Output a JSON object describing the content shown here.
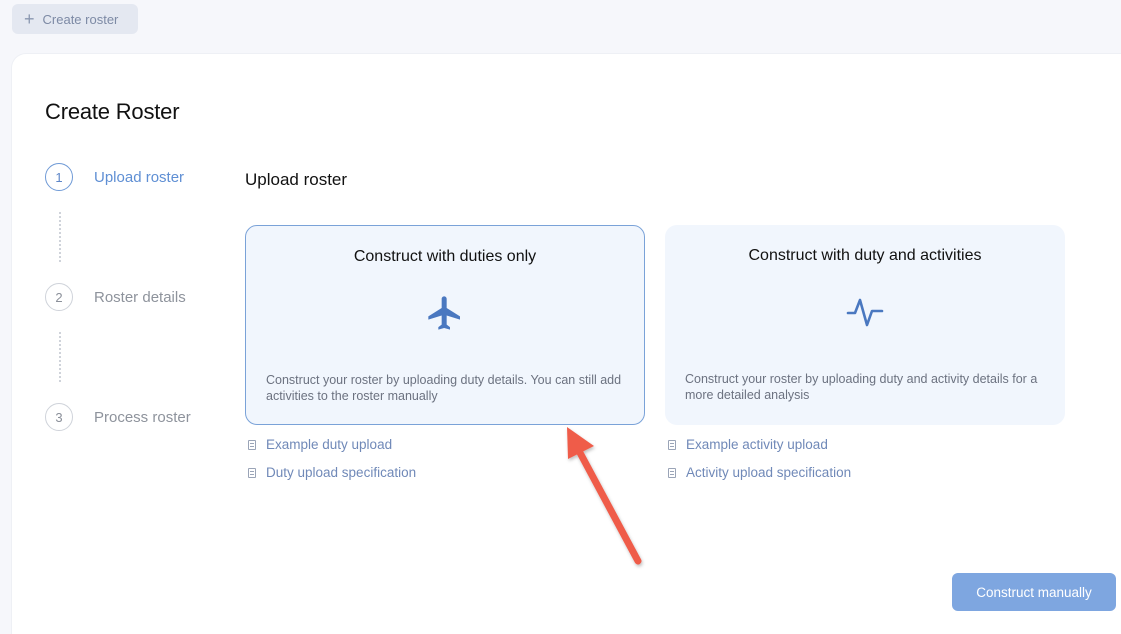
{
  "top_bar": {
    "create_roster_label": "Create roster",
    "plus_icon": "plus-icon"
  },
  "dialog": {
    "title": "Create Roster"
  },
  "steps": [
    {
      "number": "1",
      "label": "Upload roster",
      "active": true
    },
    {
      "number": "2",
      "label": "Roster details",
      "active": false
    },
    {
      "number": "3",
      "label": "Process roster",
      "active": false
    }
  ],
  "upload": {
    "section_title": "Upload roster",
    "cards": [
      {
        "title": "Construct with duties only",
        "icon": "airplane-icon",
        "description": "Construct your roster by uploading duty details. You can still add activities to the roster manually",
        "selected": true,
        "links": [
          "Example duty upload",
          "Duty upload specification"
        ]
      },
      {
        "title": "Construct with duty and activities",
        "icon": "activity-pulse-icon",
        "description": "Construct your roster by uploading duty and activity details for a more detailed analysis",
        "selected": false,
        "links": [
          "Example activity upload",
          "Activity upload specification"
        ]
      }
    ]
  },
  "footer": {
    "construct_manually_label": "Construct manually"
  },
  "colors": {
    "accent": "#5f8fd4",
    "card_bg": "#f1f6fd",
    "button_bg": "#7ea6e0",
    "arrow": "#ef5b4a"
  }
}
